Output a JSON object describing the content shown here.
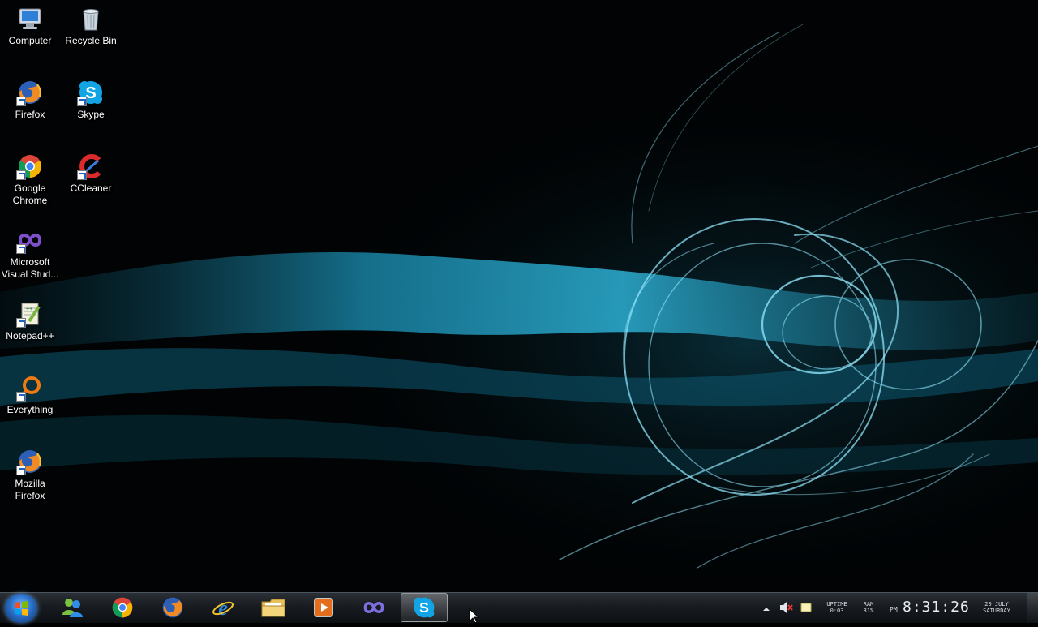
{
  "desktop": {
    "icons": [
      {
        "label": "Computer",
        "icon": "computer-icon"
      },
      {
        "label": "Recycle Bin",
        "icon": "recycle-bin-icon"
      },
      {
        "label": "Firefox",
        "icon": "firefox-icon"
      },
      {
        "label": "Skype",
        "icon": "skype-icon"
      },
      {
        "label": "Google Chrome",
        "icon": "chrome-icon"
      },
      {
        "label": "CCleaner",
        "icon": "ccleaner-icon"
      },
      {
        "label": "Microsoft Visual Stud...",
        "icon": "visual-studio-icon"
      },
      {
        "label": "Notepad++",
        "icon": "notepadpp-icon"
      },
      {
        "label": "Everything",
        "icon": "everything-icon"
      },
      {
        "label": "Mozilla Firefox",
        "icon": "firefox-icon"
      }
    ]
  },
  "taskbar": {
    "pinned": [
      {
        "icon": "messenger-icon"
      },
      {
        "icon": "chrome-icon"
      },
      {
        "icon": "firefox-icon"
      },
      {
        "icon": "internet-explorer-icon"
      },
      {
        "icon": "file-explorer-icon"
      },
      {
        "icon": "media-player-icon"
      },
      {
        "icon": "visual-studio-icon"
      },
      {
        "icon": "skype-icon",
        "active": true
      }
    ],
    "tray": {
      "uptime_label": "UPTIME",
      "uptime_value": "0:03",
      "ram_label": "RAM",
      "ram_value": "31%",
      "ampm": "PM",
      "time": "8:31:26",
      "date": "20 JULY",
      "weekday": "SATURDAY"
    }
  },
  "colors": {
    "wallpaper_accent": "#3fc6e8",
    "taskbar": "#181c21"
  }
}
